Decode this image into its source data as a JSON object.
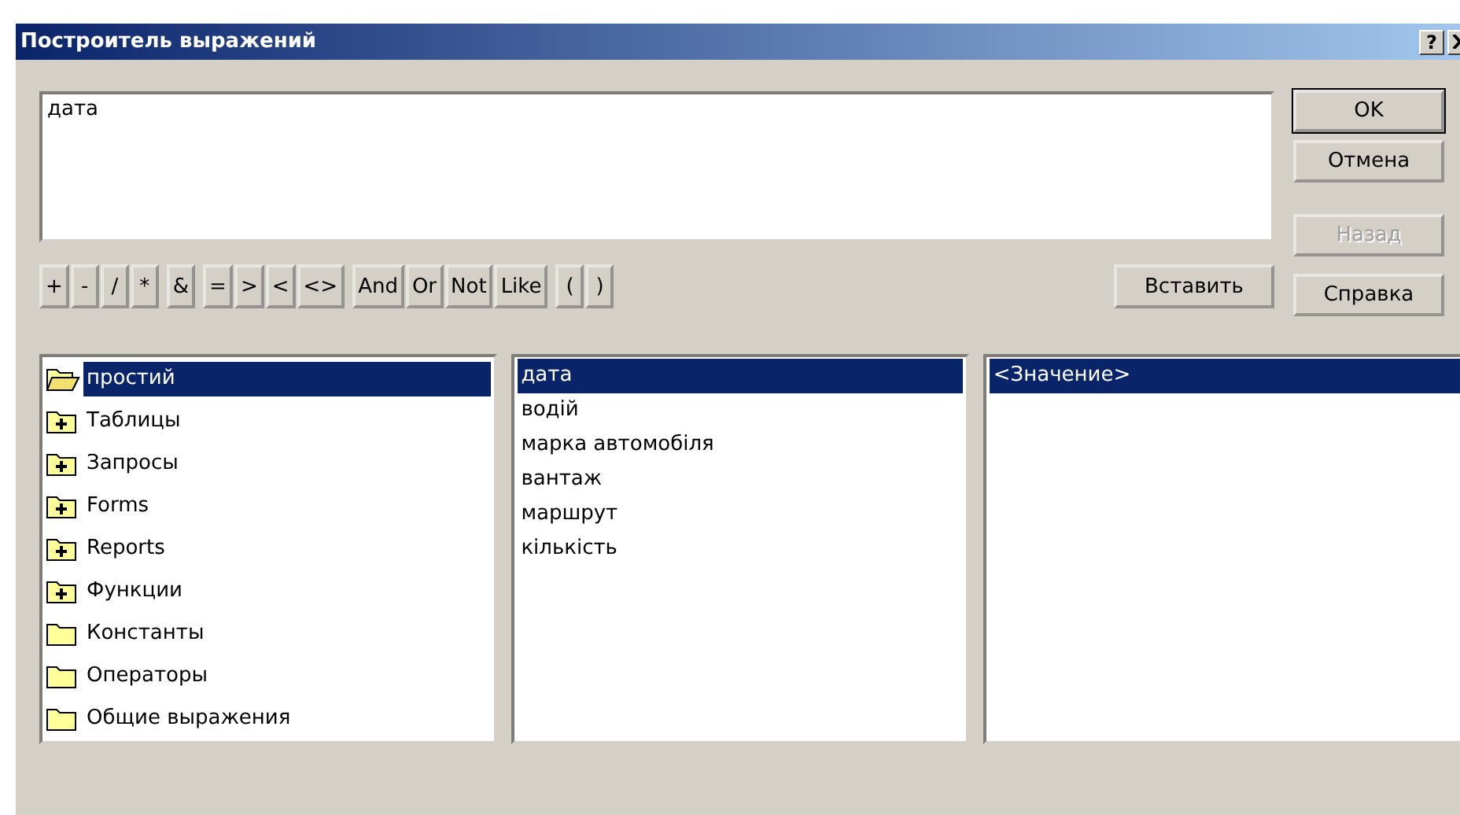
{
  "window": {
    "title": "Построитель выражений",
    "help_button": "?"
  },
  "expression": {
    "value": "дата"
  },
  "operator_groups": [
    [
      "+",
      "-",
      "/",
      "*"
    ],
    [
      "&"
    ],
    [
      "=",
      ">",
      "<",
      "<>"
    ],
    [
      "And",
      "Or",
      "Not",
      "Like"
    ],
    [
      "(",
      ")"
    ]
  ],
  "insert_button": "Вставить",
  "side_buttons": [
    {
      "label": "OK",
      "default": true,
      "disabled": false
    },
    {
      "label": "Отмена",
      "default": false,
      "disabled": false
    },
    {
      "label": "Назад",
      "default": false,
      "disabled": true
    },
    {
      "label": "Справка",
      "default": false,
      "disabled": false
    }
  ],
  "tree": [
    {
      "label": "простий",
      "kind": "open",
      "selected": true
    },
    {
      "label": "Таблицы",
      "kind": "expandable",
      "selected": false
    },
    {
      "label": "Запросы",
      "kind": "expandable",
      "selected": false
    },
    {
      "label": "Forms",
      "kind": "expandable",
      "selected": false
    },
    {
      "label": "Reports",
      "kind": "expandable",
      "selected": false
    },
    {
      "label": "Функции",
      "kind": "expandable",
      "selected": false
    },
    {
      "label": "Константы",
      "kind": "folder",
      "selected": false
    },
    {
      "label": "Операторы",
      "kind": "folder",
      "selected": false
    },
    {
      "label": "Общие выражения",
      "kind": "folder",
      "selected": false
    }
  ],
  "fields": [
    {
      "label": "дата",
      "selected": true
    },
    {
      "label": "водій",
      "selected": false
    },
    {
      "label": "марка автомобіля",
      "selected": false
    },
    {
      "label": "вантаж",
      "selected": false
    },
    {
      "label": "маршрут",
      "selected": false
    },
    {
      "label": "кількість",
      "selected": false
    }
  ],
  "values": [
    {
      "label": "<Значение>",
      "selected": true
    }
  ]
}
